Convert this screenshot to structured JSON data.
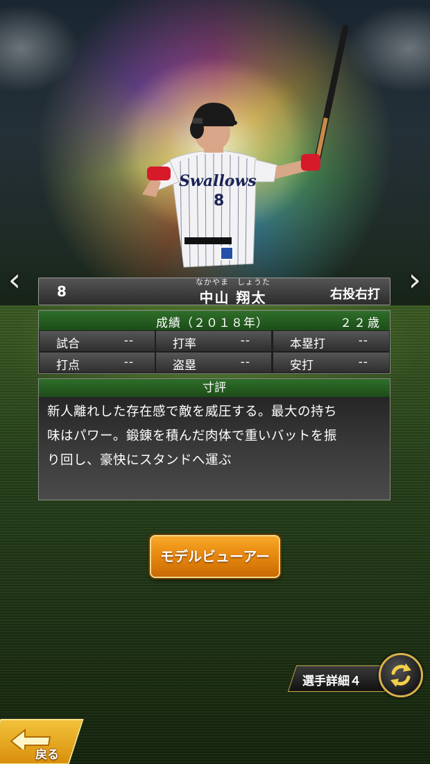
{
  "player": {
    "number": "8",
    "name_reading": "なかやま　しょうた",
    "name": "中山 翔太",
    "throw_bat": "右投右打"
  },
  "stats": {
    "title": "成績（２０１８年）",
    "age": "２２歳",
    "cells": [
      {
        "label": "試合",
        "value": "--"
      },
      {
        "label": "打率",
        "value": "--"
      },
      {
        "label": "本塁打",
        "value": "--"
      },
      {
        "label": "打点",
        "value": "--"
      },
      {
        "label": "盗塁",
        "value": "--"
      },
      {
        "label": "安打",
        "value": "--"
      }
    ]
  },
  "review": {
    "title": "寸評",
    "lines": [
      "新人離れした存在感で敵を威圧する。最大の持ち",
      "味はパワー。鍛錬を積んだ肉体で重いバットを振",
      "り回し、豪快にスタンドへ運ぶ"
    ]
  },
  "buttons": {
    "model_viewer": "モデルビューアー",
    "player_detail": "選手詳細４",
    "back": "戻る"
  },
  "uniform": {
    "team_script": "Swallows",
    "jersey_number": "8"
  },
  "nav": {
    "prev_glyph": "‹",
    "next_glyph": "›"
  },
  "colors": {
    "header_green": "#2f6e2a",
    "button_orange": "#e88a10",
    "gold_trim": "#d9b24c"
  }
}
